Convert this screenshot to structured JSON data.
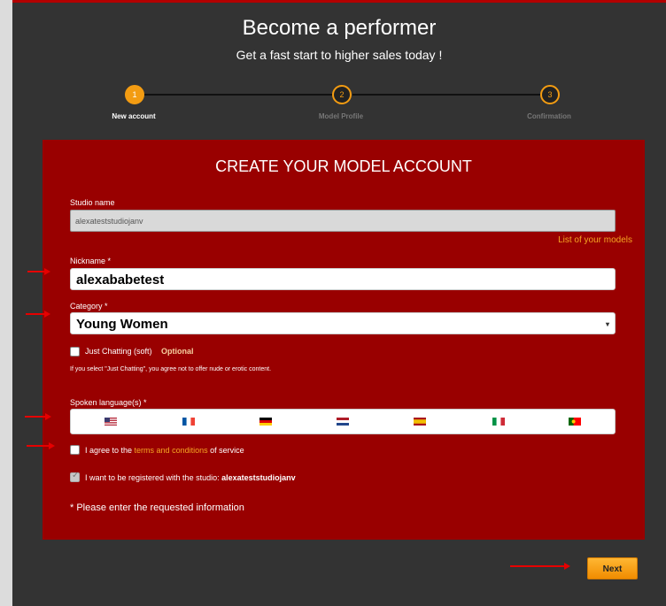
{
  "header": {
    "title": "Become a performer",
    "subtitle": "Get a fast start to higher sales today !"
  },
  "steps": [
    {
      "number": "1",
      "label": "New account",
      "active": true
    },
    {
      "number": "2",
      "label": "Model Profile",
      "active": false
    },
    {
      "number": "3",
      "label": "Confirmation",
      "active": false
    }
  ],
  "form": {
    "title": "CREATE YOUR MODEL ACCOUNT",
    "studio_label": "Studio name",
    "studio_value": "alexateststudiojanv",
    "list_models_link": "List of your models",
    "nickname_label": "Nickname *",
    "nickname_value": "alexababetest",
    "category_label": "Category *",
    "category_value": "Young Women",
    "just_chatting_label": "Just Chatting (soft)",
    "optional_label": "Optional",
    "just_chatting_note": "If you select \"Just Chatting\", you agree not to offer nude or erotic content.",
    "languages_label": "Spoken language(s) *",
    "languages": [
      {
        "name": "flag-us-icon"
      },
      {
        "name": "flag-fr-icon"
      },
      {
        "name": "flag-de-icon"
      },
      {
        "name": "flag-nl-icon"
      },
      {
        "name": "flag-es-icon"
      },
      {
        "name": "flag-it-icon"
      },
      {
        "name": "flag-pt-icon"
      }
    ],
    "agree_prefix": "I agree to the ",
    "terms_link": "terms and conditions",
    "agree_suffix": " of service",
    "register_prefix": "I want to be registered with the studio: ",
    "register_studio": "alexateststudiojanv",
    "required_notice": "* Please enter the requested information"
  },
  "next_label": "Next",
  "colors": {
    "accent": "#f39c12",
    "form_bg": "#990000",
    "page_bg": "#333333",
    "link": "#f5a623",
    "annotation_arrow": "#e60000"
  }
}
